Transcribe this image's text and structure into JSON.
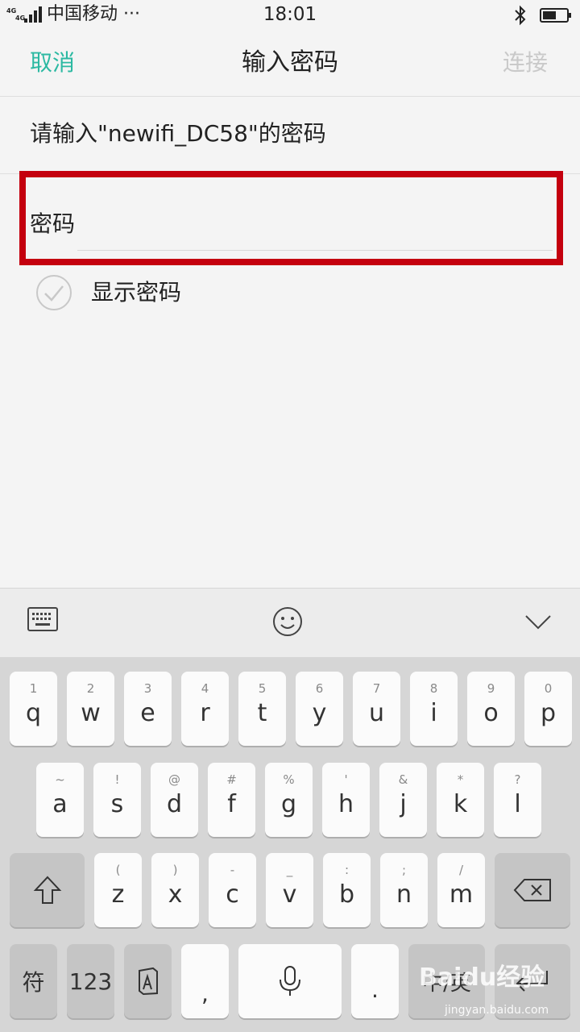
{
  "status_bar": {
    "network_1": "4G",
    "network_2": "4G",
    "carrier": "中国移动",
    "more": "···",
    "time": "18:01"
  },
  "header": {
    "cancel": "取消",
    "title": "输入密码",
    "connect": "连接"
  },
  "form": {
    "prompt": "请输入\"newifi_DC58\"的密码",
    "password_label": "密码",
    "password_value": "",
    "show_password": "显示密码"
  },
  "keyboard": {
    "row1": [
      {
        "main": "q",
        "sub": "1"
      },
      {
        "main": "w",
        "sub": "2"
      },
      {
        "main": "e",
        "sub": "3"
      },
      {
        "main": "r",
        "sub": "4"
      },
      {
        "main": "t",
        "sub": "5"
      },
      {
        "main": "y",
        "sub": "6"
      },
      {
        "main": "u",
        "sub": "7"
      },
      {
        "main": "i",
        "sub": "8"
      },
      {
        "main": "o",
        "sub": "9"
      },
      {
        "main": "p",
        "sub": "0"
      }
    ],
    "row2": [
      {
        "main": "a",
        "sub": "~"
      },
      {
        "main": "s",
        "sub": "!"
      },
      {
        "main": "d",
        "sub": "@"
      },
      {
        "main": "f",
        "sub": "#"
      },
      {
        "main": "g",
        "sub": "%"
      },
      {
        "main": "h",
        "sub": "'"
      },
      {
        "main": "j",
        "sub": "&"
      },
      {
        "main": "k",
        "sub": "*"
      },
      {
        "main": "l",
        "sub": "?"
      }
    ],
    "row3": [
      {
        "main": "z",
        "sub": "("
      },
      {
        "main": "x",
        "sub": ")"
      },
      {
        "main": "c",
        "sub": "-"
      },
      {
        "main": "v",
        "sub": "_"
      },
      {
        "main": "b",
        "sub": ":"
      },
      {
        "main": "n",
        "sub": ";"
      },
      {
        "main": "m",
        "sub": "/"
      }
    ],
    "symbol": "符",
    "numbers": "123",
    "comma": ",",
    "period": ".",
    "lang": "中/英"
  },
  "watermark": {
    "logo": "Baidu经验",
    "url": "jingyan.baidu.com"
  },
  "colors": {
    "accent": "#2cb9a2",
    "highlight_box": "#c4000e",
    "disabled": "#c9c9c9"
  },
  "icons": {
    "keyboard_toolbar": [
      "keyboard-icon",
      "emoji-icon",
      "collapse-chevron-icon"
    ],
    "keys": [
      "shift-icon",
      "backspace-icon",
      "handwriting-icon",
      "microphone-icon",
      "enter-icon"
    ]
  }
}
